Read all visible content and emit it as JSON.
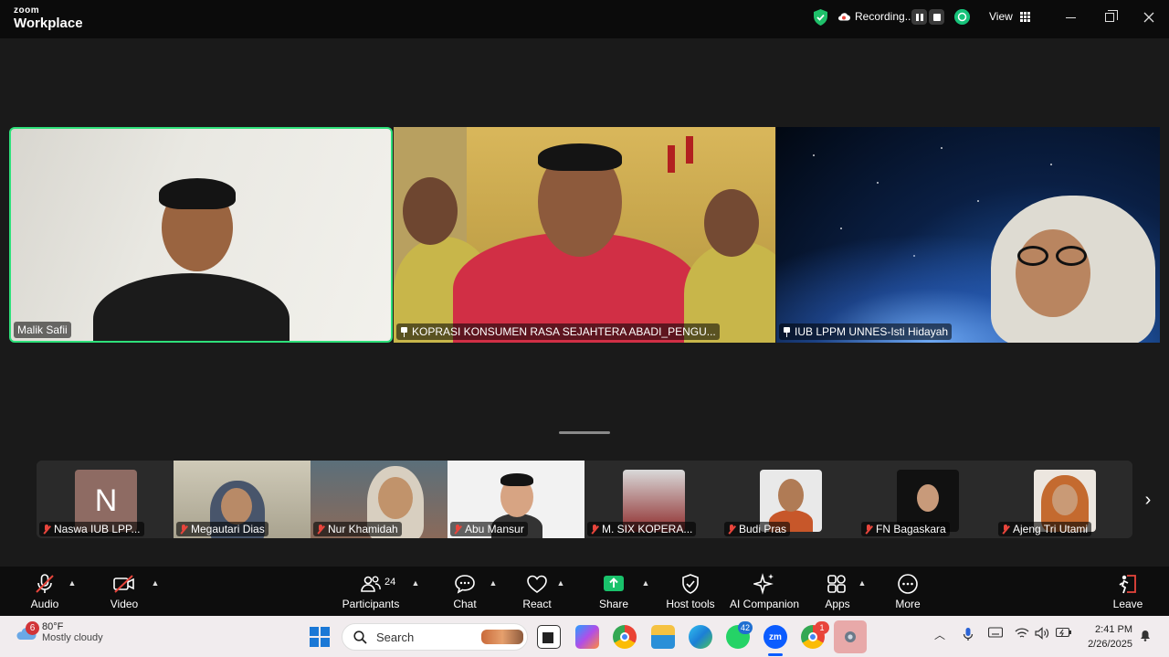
{
  "app": {
    "logo_top": "zoom",
    "logo_bottom": "Workplace"
  },
  "titlebar": {
    "recording_label": "Recording...",
    "view_label": "View"
  },
  "main_tiles": [
    {
      "name": "Malik Safii",
      "active_speaker": true,
      "pinned": false
    },
    {
      "name": "KOPRASI KONSUMEN RASA SEJAHTERA ABADI_PENGU...",
      "active_speaker": false,
      "pinned": true
    },
    {
      "name": "IUB LPPM UNNES-Isti Hidayah",
      "active_speaker": false,
      "pinned": true
    }
  ],
  "thumbnails": [
    {
      "name": "Naswa IUB LPP...",
      "avatar_letter": "N",
      "muted": true
    },
    {
      "name": "Megautari Dias",
      "muted": true
    },
    {
      "name": "Nur Khamidah",
      "muted": true
    },
    {
      "name": "Abu Mansur",
      "muted": true
    },
    {
      "name": "M. SIX KOPERA...",
      "muted": true
    },
    {
      "name": "Budi Pras",
      "muted": true
    },
    {
      "name": "FN Bagaskara",
      "muted": true
    },
    {
      "name": "Ajeng Tri Utami",
      "muted": true
    }
  ],
  "toolbar": {
    "audio": "Audio",
    "video": "Video",
    "participants": "Participants",
    "participants_count": "24",
    "chat": "Chat",
    "react": "React",
    "share": "Share",
    "host_tools": "Host tools",
    "ai_companion": "AI Companion",
    "apps": "Apps",
    "more": "More",
    "leave": "Leave"
  },
  "taskbar": {
    "weather_temp": "80°F",
    "weather_desc": "Mostly cloudy",
    "weather_badge": "6",
    "search_placeholder": "Search",
    "whatsapp_badge": "42",
    "chrome_badge": "1",
    "time": "2:41 PM",
    "date": "2/26/2025"
  },
  "colors": {
    "active_speaker_border": "#2ee07a",
    "share_green": "#19c26b",
    "muted_red": "#e8453c",
    "leave_red": "#e8453c"
  }
}
